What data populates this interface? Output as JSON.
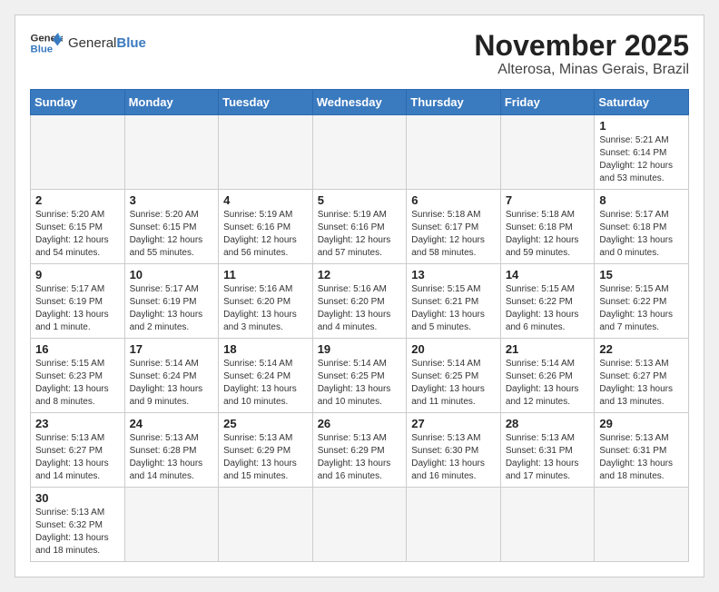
{
  "header": {
    "logo_general": "General",
    "logo_blue": "Blue",
    "month_title": "November 2025",
    "location": "Alterosa, Minas Gerais, Brazil"
  },
  "weekdays": [
    "Sunday",
    "Monday",
    "Tuesday",
    "Wednesday",
    "Thursday",
    "Friday",
    "Saturday"
  ],
  "days": {
    "d1": {
      "num": "1",
      "sunrise": "5:21 AM",
      "sunset": "6:14 PM",
      "daylight": "12 hours and 53 minutes."
    },
    "d2": {
      "num": "2",
      "sunrise": "5:20 AM",
      "sunset": "6:15 PM",
      "daylight": "12 hours and 54 minutes."
    },
    "d3": {
      "num": "3",
      "sunrise": "5:20 AM",
      "sunset": "6:15 PM",
      "daylight": "12 hours and 55 minutes."
    },
    "d4": {
      "num": "4",
      "sunrise": "5:19 AM",
      "sunset": "6:16 PM",
      "daylight": "12 hours and 56 minutes."
    },
    "d5": {
      "num": "5",
      "sunrise": "5:19 AM",
      "sunset": "6:16 PM",
      "daylight": "12 hours and 57 minutes."
    },
    "d6": {
      "num": "6",
      "sunrise": "5:18 AM",
      "sunset": "6:17 PM",
      "daylight": "12 hours and 58 minutes."
    },
    "d7": {
      "num": "7",
      "sunrise": "5:18 AM",
      "sunset": "6:18 PM",
      "daylight": "12 hours and 59 minutes."
    },
    "d8": {
      "num": "8",
      "sunrise": "5:17 AM",
      "sunset": "6:18 PM",
      "daylight": "13 hours and 0 minutes."
    },
    "d9": {
      "num": "9",
      "sunrise": "5:17 AM",
      "sunset": "6:19 PM",
      "daylight": "13 hours and 1 minute."
    },
    "d10": {
      "num": "10",
      "sunrise": "5:17 AM",
      "sunset": "6:19 PM",
      "daylight": "13 hours and 2 minutes."
    },
    "d11": {
      "num": "11",
      "sunrise": "5:16 AM",
      "sunset": "6:20 PM",
      "daylight": "13 hours and 3 minutes."
    },
    "d12": {
      "num": "12",
      "sunrise": "5:16 AM",
      "sunset": "6:20 PM",
      "daylight": "13 hours and 4 minutes."
    },
    "d13": {
      "num": "13",
      "sunrise": "5:15 AM",
      "sunset": "6:21 PM",
      "daylight": "13 hours and 5 minutes."
    },
    "d14": {
      "num": "14",
      "sunrise": "5:15 AM",
      "sunset": "6:22 PM",
      "daylight": "13 hours and 6 minutes."
    },
    "d15": {
      "num": "15",
      "sunrise": "5:15 AM",
      "sunset": "6:22 PM",
      "daylight": "13 hours and 7 minutes."
    },
    "d16": {
      "num": "16",
      "sunrise": "5:15 AM",
      "sunset": "6:23 PM",
      "daylight": "13 hours and 8 minutes."
    },
    "d17": {
      "num": "17",
      "sunrise": "5:14 AM",
      "sunset": "6:24 PM",
      "daylight": "13 hours and 9 minutes."
    },
    "d18": {
      "num": "18",
      "sunrise": "5:14 AM",
      "sunset": "6:24 PM",
      "daylight": "13 hours and 10 minutes."
    },
    "d19": {
      "num": "19",
      "sunrise": "5:14 AM",
      "sunset": "6:25 PM",
      "daylight": "13 hours and 10 minutes."
    },
    "d20": {
      "num": "20",
      "sunrise": "5:14 AM",
      "sunset": "6:25 PM",
      "daylight": "13 hours and 11 minutes."
    },
    "d21": {
      "num": "21",
      "sunrise": "5:14 AM",
      "sunset": "6:26 PM",
      "daylight": "13 hours and 12 minutes."
    },
    "d22": {
      "num": "22",
      "sunrise": "5:13 AM",
      "sunset": "6:27 PM",
      "daylight": "13 hours and 13 minutes."
    },
    "d23": {
      "num": "23",
      "sunrise": "5:13 AM",
      "sunset": "6:27 PM",
      "daylight": "13 hours and 14 minutes."
    },
    "d24": {
      "num": "24",
      "sunrise": "5:13 AM",
      "sunset": "6:28 PM",
      "daylight": "13 hours and 14 minutes."
    },
    "d25": {
      "num": "25",
      "sunrise": "5:13 AM",
      "sunset": "6:29 PM",
      "daylight": "13 hours and 15 minutes."
    },
    "d26": {
      "num": "26",
      "sunrise": "5:13 AM",
      "sunset": "6:29 PM",
      "daylight": "13 hours and 16 minutes."
    },
    "d27": {
      "num": "27",
      "sunrise": "5:13 AM",
      "sunset": "6:30 PM",
      "daylight": "13 hours and 16 minutes."
    },
    "d28": {
      "num": "28",
      "sunrise": "5:13 AM",
      "sunset": "6:31 PM",
      "daylight": "13 hours and 17 minutes."
    },
    "d29": {
      "num": "29",
      "sunrise": "5:13 AM",
      "sunset": "6:31 PM",
      "daylight": "13 hours and 18 minutes."
    },
    "d30": {
      "num": "30",
      "sunrise": "5:13 AM",
      "sunset": "6:32 PM",
      "daylight": "13 hours and 18 minutes."
    }
  },
  "labels": {
    "sunrise": "Sunrise:",
    "sunset": "Sunset:",
    "daylight": "Daylight:"
  }
}
